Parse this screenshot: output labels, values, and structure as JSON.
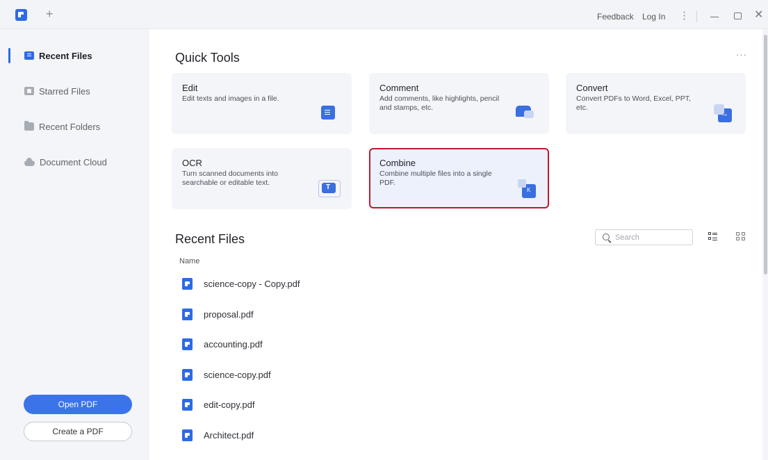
{
  "titlebar": {
    "new_tab_symbol": "+",
    "feedback": "Feedback",
    "login": "Log In",
    "kebab_symbol": "⋮",
    "close_symbol": "✕"
  },
  "sidebar": {
    "items": [
      {
        "label": "Recent Files",
        "icon": "document-icon",
        "active": true
      },
      {
        "label": "Starred Files",
        "icon": "star-file-icon",
        "active": false
      },
      {
        "label": "Recent Folders",
        "icon": "folder-icon",
        "active": false
      },
      {
        "label": "Document Cloud",
        "icon": "cloud-icon",
        "active": false
      }
    ],
    "open_pdf": "Open PDF",
    "create_pdf": "Create a PDF"
  },
  "main": {
    "more_symbol": "···",
    "quick_tools_title": "Quick Tools",
    "tools": [
      {
        "name": "Edit",
        "desc": "Edit texts and images in a file.",
        "icon": "edit-icon"
      },
      {
        "name": "Comment",
        "desc": "Add comments, like highlights, pencil and stamps, etc.",
        "icon": "comment-icon"
      },
      {
        "name": "Convert",
        "desc": "Convert PDFs to Word, Excel, PPT, etc.",
        "icon": "convert-icon"
      },
      {
        "name": "OCR",
        "desc": "Turn scanned documents into searchable or editable text.",
        "icon": "ocr-icon"
      },
      {
        "name": "Combine",
        "desc": "Combine multiple files into a single PDF.",
        "icon": "combine-icon",
        "highlighted": true
      }
    ],
    "recent_files_title": "Recent Files",
    "search_placeholder": "Search",
    "column_name": "Name",
    "files": [
      "science-copy - Copy.pdf",
      "proposal.pdf",
      "accounting.pdf",
      "science-copy.pdf",
      "edit-copy.pdf",
      "Architect.pdf"
    ]
  },
  "colors": {
    "accent": "#2d6be6",
    "highlight_border": "#c4162f"
  }
}
